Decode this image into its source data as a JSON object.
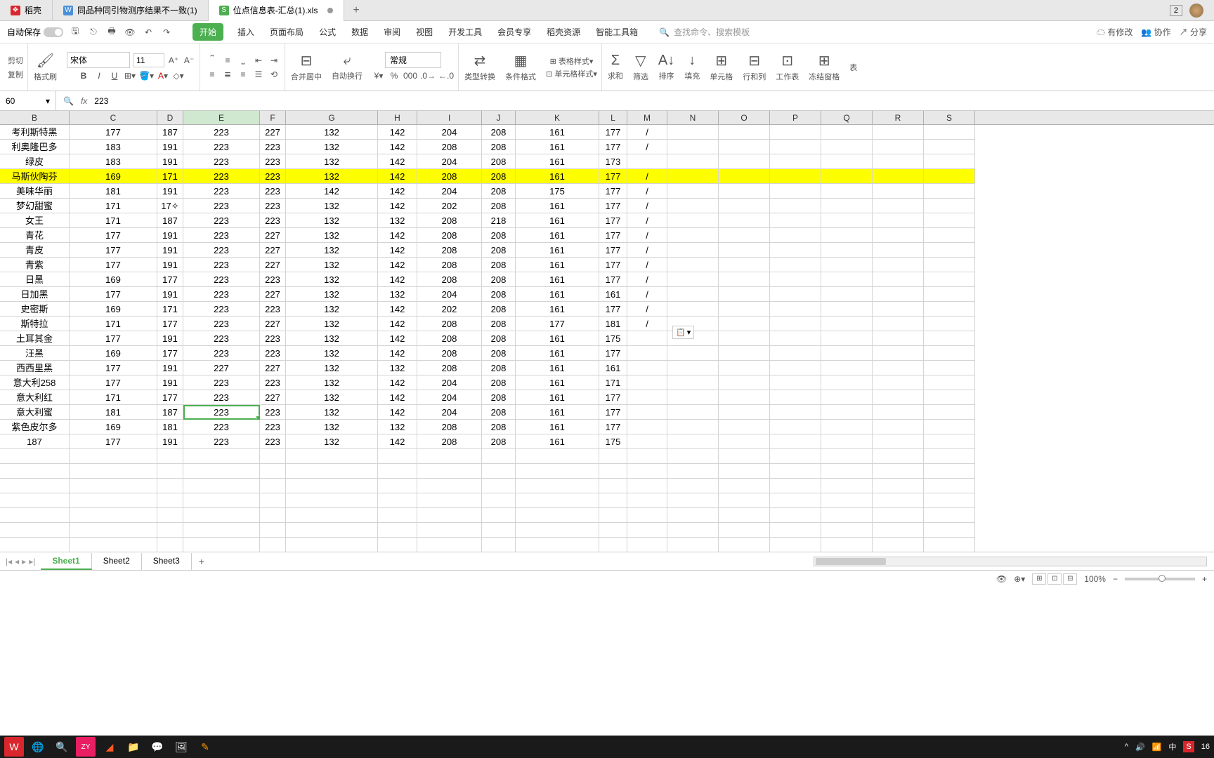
{
  "tabs": {
    "t1": "稻壳",
    "t2": "同品种同引物测序结果不一致(1)",
    "t3": "位点信息表-汇总(1).xls",
    "add": "+",
    "badge": "2"
  },
  "ribbon": {
    "autosave": "自动保存",
    "menu": {
      "start": "开始",
      "insert": "插入",
      "layout": "页面布局",
      "formula": "公式",
      "data": "数据",
      "review": "审阅",
      "view": "视图",
      "dev": "开发工具",
      "member": "会员专享",
      "res": "稻壳资源",
      "smart": "智能工具箱"
    },
    "search_ph": "查找命令、搜索模板",
    "right": {
      "changes": "有修改",
      "coop": "协作",
      "share": "分享"
    },
    "tools": {
      "cut": "剪切",
      "copy": "复制",
      "brush": "格式刷",
      "font": "宋体",
      "size": "11",
      "merge": "合并居中",
      "wrap": "自动换行",
      "general": "常规",
      "type": "类型转换",
      "cond": "条件格式",
      "tstyle": "表格样式",
      "cstyle": "单元格样式",
      "sum": "求和",
      "filter": "筛选",
      "sort": "排序",
      "fill": "填充",
      "cells": "单元格",
      "rowcol": "行和列",
      "sheet": "工作表",
      "freeze": "冻结窗格",
      "more": "表"
    }
  },
  "namebox": "60",
  "formula": "223",
  "fx": "fx",
  "columns": [
    "B",
    "C",
    "D",
    "E",
    "F",
    "G",
    "H",
    "I",
    "J",
    "K",
    "L",
    "M",
    "N",
    "O",
    "P",
    "Q",
    "R",
    "S"
  ],
  "rows": [
    {
      "b": "考利斯特黑",
      "c": "177",
      "d": "187",
      "e": "223",
      "f": "227",
      "g": "132",
      "h": "142",
      "i": "204",
      "j": "208",
      "k": "161",
      "l": "177",
      "m": "/"
    },
    {
      "b": "利奥隆巴多",
      "c": "183",
      "d": "191",
      "e": "223",
      "f": "223",
      "g": "132",
      "h": "142",
      "i": "208",
      "j": "208",
      "k": "161",
      "l": "177",
      "m": "/"
    },
    {
      "b": "绿皮",
      "c": "183",
      "d": "191",
      "e": "223",
      "f": "223",
      "g": "132",
      "h": "142",
      "i": "204",
      "j": "208",
      "k": "161",
      "l": "173",
      "m": ""
    },
    {
      "b": "马斯伙陶芬",
      "c": "169",
      "d": "171",
      "e": "223",
      "f": "223",
      "g": "132",
      "h": "142",
      "i": "208",
      "j": "208",
      "k": "161",
      "l": "177",
      "m": "/",
      "hl": true
    },
    {
      "b": "美味华丽",
      "c": "181",
      "d": "191",
      "e": "223",
      "f": "223",
      "g": "142",
      "h": "142",
      "i": "204",
      "j": "208",
      "k": "175",
      "l": "177",
      "m": "/"
    },
    {
      "b": "梦幻甜蜜",
      "c": "171",
      "d": "17✧",
      "e": "223",
      "f": "223",
      "g": "132",
      "h": "142",
      "i": "202",
      "j": "208",
      "k": "161",
      "l": "177",
      "m": "/"
    },
    {
      "b": "女王",
      "c": "171",
      "d": "187",
      "e": "223",
      "f": "223",
      "g": "132",
      "h": "132",
      "i": "208",
      "j": "218",
      "k": "161",
      "l": "177",
      "m": "/"
    },
    {
      "b": "青花",
      "c": "177",
      "d": "191",
      "e": "223",
      "f": "227",
      "g": "132",
      "h": "142",
      "i": "208",
      "j": "208",
      "k": "161",
      "l": "177",
      "m": "/"
    },
    {
      "b": "青皮",
      "c": "177",
      "d": "191",
      "e": "223",
      "f": "227",
      "g": "132",
      "h": "142",
      "i": "208",
      "j": "208",
      "k": "161",
      "l": "177",
      "m": "/"
    },
    {
      "b": "青紫",
      "c": "177",
      "d": "191",
      "e": "223",
      "f": "227",
      "g": "132",
      "h": "142",
      "i": "208",
      "j": "208",
      "k": "161",
      "l": "177",
      "m": "/"
    },
    {
      "b": "日黑",
      "c": "169",
      "d": "177",
      "e": "223",
      "f": "223",
      "g": "132",
      "h": "142",
      "i": "208",
      "j": "208",
      "k": "161",
      "l": "177",
      "m": "/"
    },
    {
      "b": "日加黑",
      "c": "177",
      "d": "191",
      "e": "223",
      "f": "227",
      "g": "132",
      "h": "132",
      "i": "204",
      "j": "208",
      "k": "161",
      "l": "161",
      "m": "/"
    },
    {
      "b": "史密斯",
      "c": "169",
      "d": "171",
      "e": "223",
      "f": "223",
      "g": "132",
      "h": "142",
      "i": "202",
      "j": "208",
      "k": "161",
      "l": "177",
      "m": "/"
    },
    {
      "b": "斯特拉",
      "c": "171",
      "d": "177",
      "e": "223",
      "f": "227",
      "g": "132",
      "h": "142",
      "i": "208",
      "j": "208",
      "k": "177",
      "l": "181",
      "m": "/"
    },
    {
      "b": "土耳其金",
      "c": "177",
      "d": "191",
      "e": "223",
      "f": "223",
      "g": "132",
      "h": "142",
      "i": "208",
      "j": "208",
      "k": "161",
      "l": "175",
      "m": ""
    },
    {
      "b": "汪黑",
      "c": "169",
      "d": "177",
      "e": "223",
      "f": "223",
      "g": "132",
      "h": "142",
      "i": "208",
      "j": "208",
      "k": "161",
      "l": "177",
      "m": ""
    },
    {
      "b": "西西里黑",
      "c": "177",
      "d": "191",
      "e": "227",
      "f": "227",
      "g": "132",
      "h": "132",
      "i": "208",
      "j": "208",
      "k": "161",
      "l": "161",
      "m": ""
    },
    {
      "b": "意大利258",
      "c": "177",
      "d": "191",
      "e": "223",
      "f": "223",
      "g": "132",
      "h": "142",
      "i": "204",
      "j": "208",
      "k": "161",
      "l": "171",
      "m": ""
    },
    {
      "b": "意大利红",
      "c": "171",
      "d": "177",
      "e": "223",
      "f": "227",
      "g": "132",
      "h": "142",
      "i": "204",
      "j": "208",
      "k": "161",
      "l": "177",
      "m": ""
    },
    {
      "b": "意大利蜜",
      "c": "181",
      "d": "187",
      "e": "223",
      "f": "223",
      "g": "132",
      "h": "142",
      "i": "204",
      "j": "208",
      "k": "161",
      "l": "177",
      "m": "",
      "active": true
    },
    {
      "b": "紫色皮尔多",
      "c": "169",
      "d": "181",
      "e": "223",
      "f": "223",
      "g": "132",
      "h": "132",
      "i": "208",
      "j": "208",
      "k": "161",
      "l": "177",
      "m": ""
    },
    {
      "b": "187",
      "c": "177",
      "d": "191",
      "e": "223",
      "f": "223",
      "g": "132",
      "h": "142",
      "i": "208",
      "j": "208",
      "k": "161",
      "l": "175",
      "m": ""
    }
  ],
  "sheets": {
    "s1": "Sheet1",
    "s2": "Sheet2",
    "s3": "Sheet3"
  },
  "status": {
    "zoom": "100%"
  },
  "taskbar": {
    "time": "16",
    "ime": "中",
    "s": "S"
  }
}
